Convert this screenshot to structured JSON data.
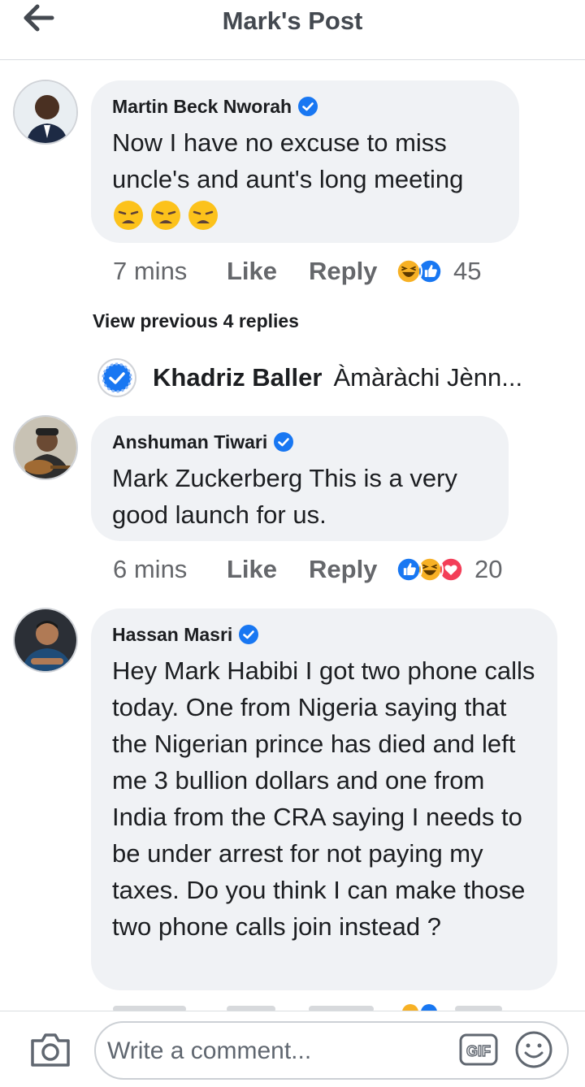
{
  "header": {
    "title": "Mark's Post"
  },
  "comments": [
    {
      "author": "Martin Beck Nworah",
      "verified": true,
      "text": "Now I have no excuse to miss uncle's and aunt's long meeting",
      "emoji": [
        "weary-face",
        "weary-face",
        "weary-face"
      ],
      "time": "7 mins",
      "like": "Like",
      "reply": "Reply",
      "reactions": [
        "haha",
        "like"
      ],
      "reaction_count": "45"
    },
    {
      "author": "Anshuman Tiwari",
      "verified": true,
      "text": "Mark Zuckerberg This is a very good launch for us.",
      "time": "6 mins",
      "like": "Like",
      "reply": "Reply",
      "reactions": [
        "like",
        "haha",
        "love"
      ],
      "reaction_count": "20"
    },
    {
      "author": "Hassan Masri",
      "verified": true,
      "text": "Hey Mark Habibi I got two phone calls today. One from Nigeria saying that the Nigerian prince has died and left me 3 bullion dollars and one from India from the CRA saying I needs to be under arrest for not paying my taxes. Do you think I can make those two phone calls join instead ?"
    }
  ],
  "view_previous": "View previous 4 replies",
  "reply_preview": {
    "name": "Khadriz Baller",
    "text": "Àmàràchi Jènn..."
  },
  "composer": {
    "placeholder": "Write a comment...",
    "gif_label": "GIF"
  },
  "colors": {
    "verified_blue": "#1877f2",
    "bubble": "#f0f2f5",
    "meta_gray": "#65676b",
    "love_red": "#f33e58",
    "haha_yellow": "#f7b125"
  }
}
